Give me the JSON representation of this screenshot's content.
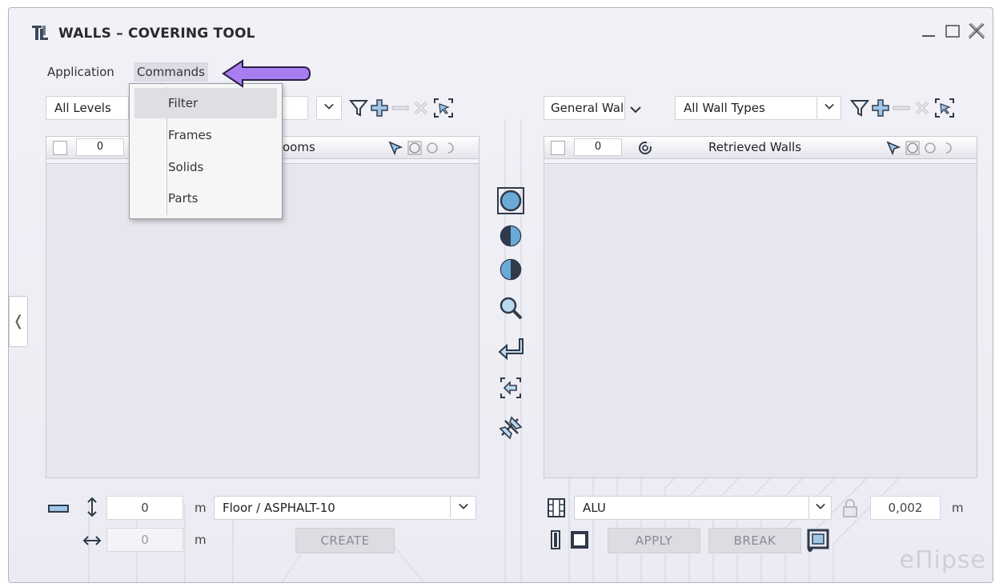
{
  "window": {
    "title": "WALLS – COVERING TOOL",
    "controls": {
      "minimize": "_",
      "maximize": "☐",
      "close": "✕"
    },
    "collapse_glyph": "❬"
  },
  "menubar": {
    "items": [
      "Application",
      "Commands"
    ]
  },
  "commands_menu": {
    "items": [
      "Filter",
      "Frames",
      "Solids",
      "Parts"
    ],
    "highlighted": "Filter"
  },
  "left_panel": {
    "level_combo": "All Levels",
    "list_count": "0",
    "list_title": "ooms"
  },
  "right_panel": {
    "group_combo": "General Wal",
    "type_combo": "All Wall Types",
    "list_count": "0",
    "list_title": "Retrieved Walls"
  },
  "left_bottom": {
    "height_value": "0",
    "height_unit": "m",
    "material_combo": "Floor / ASPHALT-10",
    "width_value": "0",
    "width_unit": "m",
    "create_label": "CREATE"
  },
  "right_bottom": {
    "material_combo": "ALU",
    "thickness_value": "0,002",
    "thickness_unit": "m",
    "apply_label": "APPLY",
    "break_label": "BREAK"
  },
  "brand": "eΠipse",
  "colors": {
    "accent_blue": "#6aaad8",
    "arrow_purple": "#9b6ee8",
    "icon_dark": "#2f3a4a"
  },
  "icons": [
    "filter-icon",
    "add-icon",
    "remove-icon",
    "clear-icon",
    "select-in-model-icon",
    "pointer-icon",
    "circle-full-icon",
    "circle-left-icon",
    "circle-right-icon",
    "magnify-icon",
    "return-icon",
    "transfer-icon",
    "unpin-icon"
  ]
}
